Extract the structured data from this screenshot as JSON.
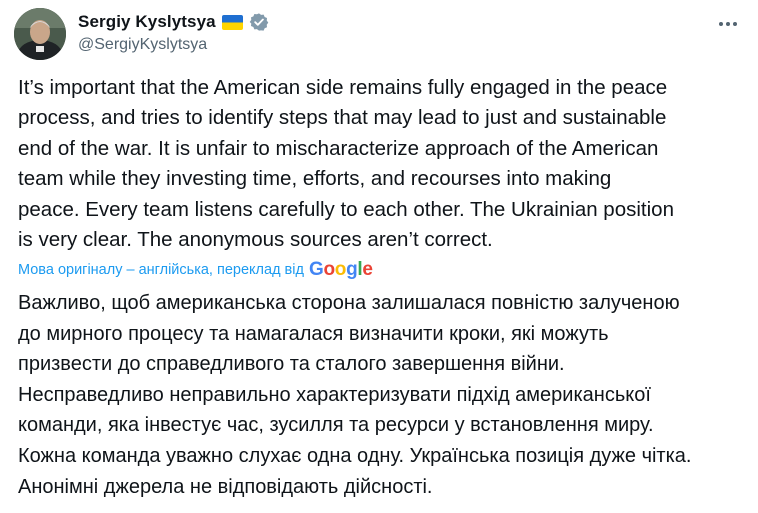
{
  "author": {
    "display_name": "Sergiy Kyslytsya",
    "handle": "@SergiyKyslytsya",
    "flag_icon": "ukraine-flag-icon",
    "verified_icon": "verified-badge-icon",
    "verified_color": "#829aab"
  },
  "tweet": {
    "text": "It’s important that the American side remains fully engaged in the peace\nprocess, and tries to identify steps that may lead to just and sustainable\nend of the war. It is unfair to mischaracterize approach of the American\nteam while they investing time, efforts, and recourses into making\npeace. Every team listens carefully to each other. The Ukrainian position\nis very clear. The anonymous sources aren’t correct."
  },
  "translation": {
    "note": "Мова оригіналу – англійська, переклад від",
    "provider": "Google",
    "text": "Важливо, щоб американська сторона залишалася повністю залученою\nдо мирного процесу та намагалася визначити кроки, які можуть\nпризвести до справедливого та сталого завершення війни.\nНесправедливо неправильно характеризувати підхід американської\nкоманди, яка інвестує час, зусилля та ресурси у встановлення миру.\nКожна команда уважно слухає одна одну. Українська позиція дуже чітка.\nАнонімні джерела не відповідають дійсності."
  },
  "colors": {
    "link": "#1d9bf0",
    "text": "#0f1419",
    "secondary": "#536471"
  }
}
